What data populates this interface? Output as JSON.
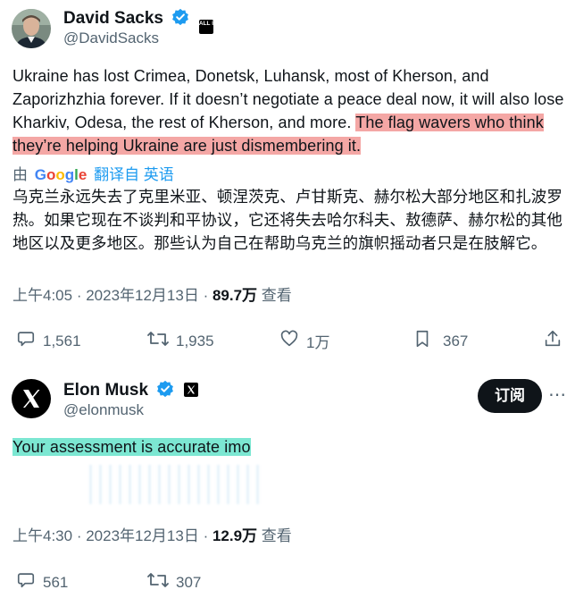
{
  "tweet1": {
    "author_name": "David Sacks",
    "author_handle": "@DavidSacks",
    "affiliate_badge": "ALL IN",
    "text_plain": "Ukraine has lost Crimea, Donetsk, Luhansk, most of Kherson, and Zaporizhzhia forever. If it doesn’t negotiate a peace deal now, it will also lose Kharkiv, Odesa, the rest of Kherson, and more. ",
    "text_highlighted": "The flag wavers who think they’re helping Ukraine are just dismembering it.",
    "translate_prefix": "由",
    "translate_provider": "Google",
    "translate_label": "翻译自 英语",
    "translation": "乌克兰永远失去了克里米亚、顿涅茨克、卢甘斯克、赫尔松大部分地区和扎波罗热。如果它现在不谈判和平协议，它还将失去哈尔科夫、敖德萨、赫尔松的其他地区以及更多地区。那些认为自己在帮助乌克兰的旗帜摇动者只是在肢解它。",
    "time": "上午4:05",
    "date": "2023年12月13日",
    "views": "89.7万",
    "views_label": "查看",
    "replies": "1,561",
    "retweets": "1,935",
    "likes": "1万",
    "bookmarks": "367"
  },
  "tweet2": {
    "author_name": "Elon Musk",
    "author_handle": "@elonmusk",
    "subscribe_label": "订阅",
    "text": "Your assessment is accurate imo",
    "time": "上午4:30",
    "date": "2023年12月13日",
    "views": "12.9万",
    "views_label": "查看",
    "replies": "561",
    "retweets": "307"
  },
  "separator": " · ",
  "colors": {
    "verified_blue": "#1d9bf0",
    "highlight_red": "#f4a7a5",
    "highlight_cyan": "#7ce7d2",
    "muted_text": "#536471"
  },
  "icons": [
    "verified-icon",
    "reply-icon",
    "retweet-icon",
    "like-icon",
    "bookmark-icon",
    "share-icon",
    "more-icon",
    "x-logo-icon"
  ]
}
